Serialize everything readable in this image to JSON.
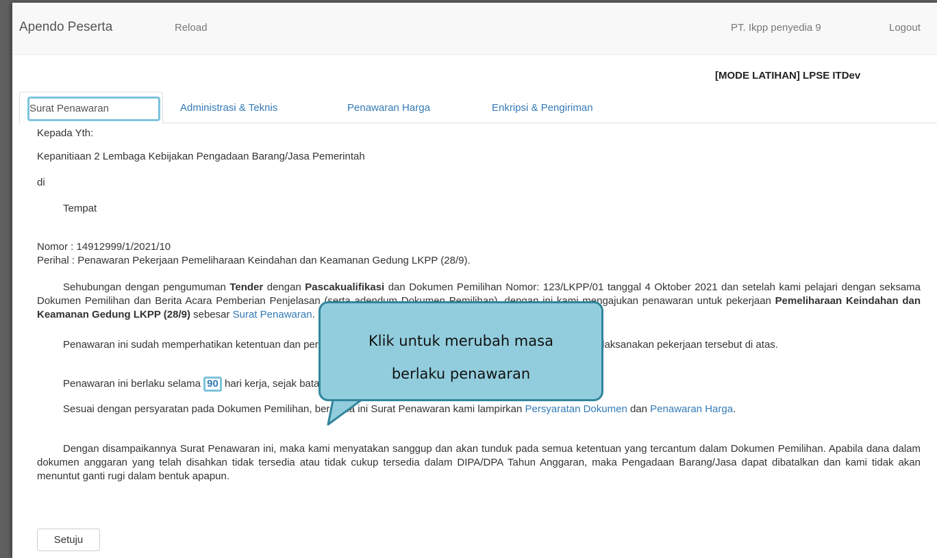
{
  "navbar": {
    "brand": "Apendo Peserta",
    "reload": "Reload",
    "user": "PT. Ikpp penyedia 9",
    "logout": "Logout"
  },
  "mode_label": "[MODE LATIHAN] LPSE ITDev",
  "tabs": [
    {
      "label": "Surat Penawaran",
      "active": true
    },
    {
      "label": "Administrasi & Teknis",
      "active": false
    },
    {
      "label": "Penawaran Harga",
      "active": false
    },
    {
      "label": "Enkripsi & Pengiriman",
      "active": false
    }
  ],
  "letter": {
    "kepada": "Kepada Yth:",
    "recipient": "Kepanitiaan 2 Lembaga Kebijakan Pengadaan Barang/Jasa Pemerintah",
    "di": "di",
    "tempat": "Tempat",
    "nomor": "Nomor : 14912999/1/2021/10",
    "perihal": "Perihal : Penawaran Pekerjaan Pemeliharaan Keindahan dan Keamanan Gedung LKPP (28/9).",
    "p1_a": "Sehubungan dengan pengumuman ",
    "p1_tender": "Tender",
    "p1_b": " dengan ",
    "p1_pasca": "Pascakualifikasi",
    "p1_c": " dan Dokumen Pemilihan Nomor: 123/LKPP/01 tanggal 4 Oktober 2021 dan setelah kami pelajari dengan seksama Dokumen Pemilihan dan Berita Acara Pemberian Penjelasan (serta adendum Dokumen Pemilihan), dengan ini kami mengajukan penawaran untuk pekerjaan ",
    "p1_job": "Pemeliharaan Keindahan dan Keamanan Gedung LKPP (28/9)",
    "p1_d": " sebesar ",
    "p1_link": "Surat Penawaran",
    "p1_e": ".",
    "p2": "Penawaran ini sudah memperhatikan ketentuan dan persyaratan yang tercantum dalam Dokumen Pemilihan untuk melaksanakan pekerjaan tersebut di atas.",
    "p3_a": "Penawaran ini berlaku selama ",
    "p3_days": "90",
    "p3_b": " hari kerja, sejak batas akhir pemasukan dokumen penawaran.",
    "p4_a": "Sesuai dengan persyaratan pada Dokumen Pemilihan, bersama ini Surat Penawaran kami lampirkan ",
    "p4_link1": "Persyaratan Dokumen",
    "p4_b": " dan ",
    "p4_link2": "Penawaran Harga",
    "p4_c": ".",
    "p5": "Dengan disampaikannya Surat Penawaran ini, maka kami menyatakan sanggup dan akan tunduk pada semua ketentuan yang tercantum dalam Dokumen Pemilihan. Apabila dana dalam dokumen anggaran yang telah disahkan tidak tersedia atau tidak cukup tersedia dalam DIPA/DPA Tahun Anggaran, maka Pengadaan Barang/Jasa dapat dibatalkan dan kami tidak akan menuntut ganti rugi dalam bentuk apapun."
  },
  "agree_button": "Setuju",
  "callout": {
    "line1": "Klik untuk merubah masa",
    "line2": "berlaku penawaran"
  }
}
